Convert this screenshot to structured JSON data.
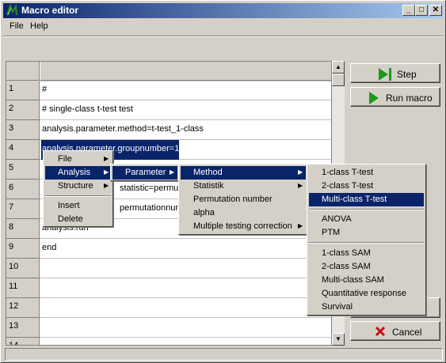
{
  "window": {
    "title": "Macro editor",
    "minimize": "_",
    "maximize": "□",
    "close": "✕"
  },
  "menubar": {
    "file": "File",
    "help": "Help"
  },
  "grid": {
    "rows": [
      {
        "num": "1",
        "text": "#"
      },
      {
        "num": "2",
        "text": "# single-class t-test test"
      },
      {
        "num": "3",
        "text": "analysis.parameter.method=t-test_1-class"
      },
      {
        "num": "4",
        "text": "analysis.parameter.groupnumber=1"
      },
      {
        "num": "5",
        "text": ""
      },
      {
        "num": "6",
        "text": "statistic=permutat"
      },
      {
        "num": "7",
        "text": "permutationnumbe"
      },
      {
        "num": "8",
        "text": "analysis.run"
      },
      {
        "num": "9",
        "text": "end"
      },
      {
        "num": "10",
        "text": ""
      },
      {
        "num": "11",
        "text": ""
      },
      {
        "num": "12",
        "text": ""
      },
      {
        "num": "13",
        "text": ""
      },
      {
        "num": "14",
        "text": ""
      }
    ]
  },
  "buttons": {
    "step": "Step",
    "run": "Run macro",
    "cancel": "Cancel"
  },
  "context_menu": {
    "file": "File",
    "analysis": "Analysis",
    "structure": "Structure",
    "insert": "Insert",
    "delete": "Delete"
  },
  "analysis_menu": {
    "parameter": "Parameter"
  },
  "parameter_menu": {
    "method": "Method",
    "statistik": "Statistik",
    "permutation": "Permutation number",
    "alpha": "alpha",
    "correction": "Multiple testing correction"
  },
  "method_menu": {
    "t1": "1-class T-test",
    "t2": "2-class T-test",
    "tmulti": "Multi-class T-test",
    "anova": "ANOVA",
    "ptm": "PTM",
    "sam1": "1-class SAM",
    "sam2": "2-class SAM",
    "sammulti": "Multi-class SAM",
    "quant": "Quantitative response",
    "survival": "Survival"
  },
  "colors": {
    "highlight": "#0a246a",
    "face": "#d4d0c8"
  }
}
